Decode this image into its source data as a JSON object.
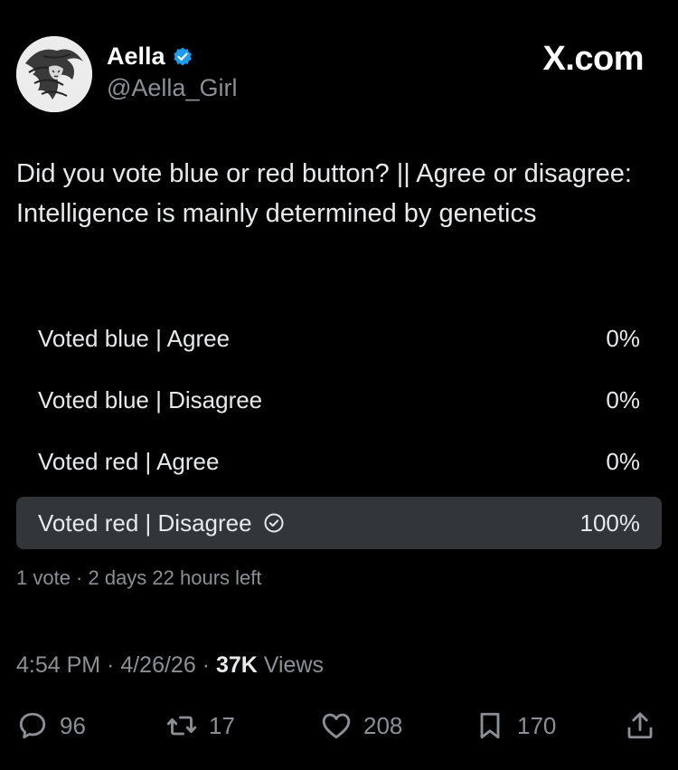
{
  "author": {
    "display_name": "Aella",
    "handle": "@Aella_Girl",
    "avatar_icon": "sketch-portrait-avatar",
    "verified_icon": "verified-badge-icon",
    "verified_color": "#1d9bf0"
  },
  "brand": "X.com",
  "tweet": {
    "text": "Did you vote blue or red button? || Agree or disagree: Intelligence is mainly determined by genetics"
  },
  "poll": {
    "options": [
      {
        "label": "Voted blue | Agree",
        "percent_text": "0%",
        "percent": 0,
        "selected": false
      },
      {
        "label": "Voted blue | Disagree",
        "percent_text": "0%",
        "percent": 0,
        "selected": false
      },
      {
        "label": "Voted red | Agree",
        "percent_text": "0%",
        "percent": 0,
        "selected": false
      },
      {
        "label": "Voted red | Disagree",
        "percent_text": "100%",
        "percent": 100,
        "selected": true
      }
    ],
    "meta": "1 vote · 2 days 22 hours left"
  },
  "timestamp": {
    "prefix": "4:54 PM · 4/26/26 · ",
    "views_count": "37K",
    "views_label": " Views"
  },
  "actions": {
    "replies": "96",
    "reposts": "17",
    "likes": "208",
    "bookmarks": "170"
  },
  "colors": {
    "background": "#000000",
    "text": "#e7e9ea",
    "muted": "#8b9097",
    "poll_fill": "#333639"
  }
}
